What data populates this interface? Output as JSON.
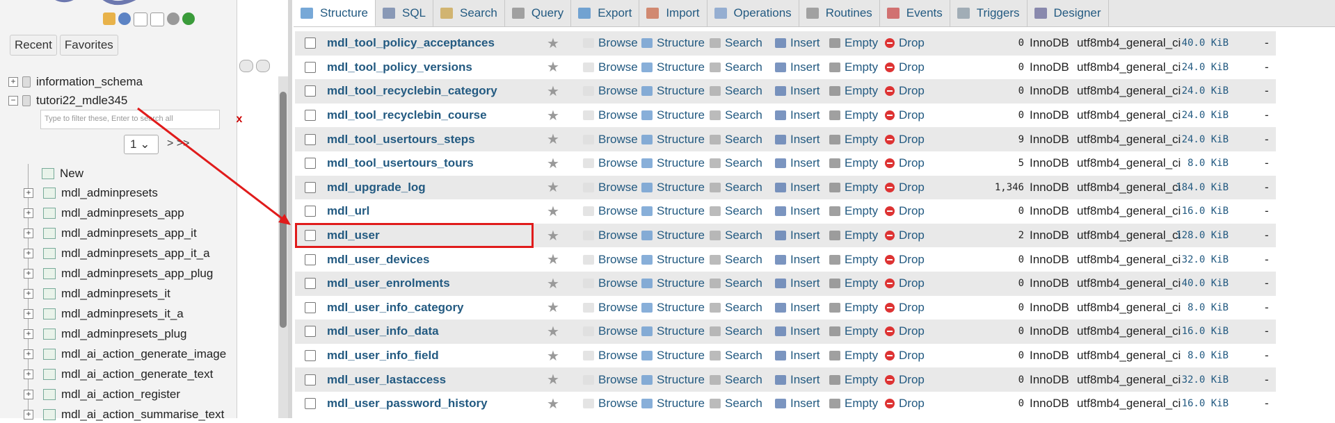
{
  "nav": {
    "recent_label": "Recent",
    "favorites_label": "Favorites",
    "databases": [
      {
        "name": "information_schema",
        "toggle": "+"
      },
      {
        "name": "tutori22_mdle345",
        "toggle": "−"
      }
    ],
    "filter_placeholder": "Type to filter these, Enter to search all",
    "filter_clear": "x",
    "page_select": "1",
    "page_next": "> >>",
    "new_label": "New",
    "tables": [
      "mdl_adminpresets",
      "mdl_adminpresets_app",
      "mdl_adminpresets_app_it",
      "mdl_adminpresets_app_it_a",
      "mdl_adminpresets_app_plug",
      "mdl_adminpresets_it",
      "mdl_adminpresets_it_a",
      "mdl_adminpresets_plug",
      "mdl_ai_action_generate_image",
      "mdl_ai_action_generate_text",
      "mdl_ai_action_register",
      "mdl_ai_action_summarise_text"
    ]
  },
  "tabs": [
    {
      "label": "Structure",
      "icon": "structure-icon"
    },
    {
      "label": "SQL",
      "icon": "sql-icon"
    },
    {
      "label": "Search",
      "icon": "search-icon"
    },
    {
      "label": "Query",
      "icon": "query-icon"
    },
    {
      "label": "Export",
      "icon": "export-icon"
    },
    {
      "label": "Import",
      "icon": "import-icon"
    },
    {
      "label": "Operations",
      "icon": "wrench-icon"
    },
    {
      "label": "Routines",
      "icon": "routines-icon"
    },
    {
      "label": "Events",
      "icon": "clock-icon"
    },
    {
      "label": "Triggers",
      "icon": "triggers-icon"
    },
    {
      "label": "Designer",
      "icon": "designer-icon"
    }
  ],
  "actions": {
    "browse": "Browse",
    "structure": "Structure",
    "search": "Search",
    "insert": "Insert",
    "empty": "Empty",
    "drop": "Drop"
  },
  "rows": [
    {
      "name": "mdl_tool_policy_acceptances",
      "rows": "0",
      "engine": "InnoDB",
      "collation": "utf8mb4_general_ci",
      "size": "40.0 KiB",
      "overhead": "-"
    },
    {
      "name": "mdl_tool_policy_versions",
      "rows": "0",
      "engine": "InnoDB",
      "collation": "utf8mb4_general_ci",
      "size": "24.0 KiB",
      "overhead": "-"
    },
    {
      "name": "mdl_tool_recyclebin_category",
      "rows": "0",
      "engine": "InnoDB",
      "collation": "utf8mb4_general_ci",
      "size": "24.0 KiB",
      "overhead": "-"
    },
    {
      "name": "mdl_tool_recyclebin_course",
      "rows": "0",
      "engine": "InnoDB",
      "collation": "utf8mb4_general_ci",
      "size": "24.0 KiB",
      "overhead": "-"
    },
    {
      "name": "mdl_tool_usertours_steps",
      "rows": "9",
      "engine": "InnoDB",
      "collation": "utf8mb4_general_ci",
      "size": "24.0 KiB",
      "overhead": "-"
    },
    {
      "name": "mdl_tool_usertours_tours",
      "rows": "5",
      "engine": "InnoDB",
      "collation": "utf8mb4_general_ci",
      "size": "8.0 KiB",
      "overhead": "-"
    },
    {
      "name": "mdl_upgrade_log",
      "rows": "1,346",
      "engine": "InnoDB",
      "collation": "utf8mb4_general_ci",
      "size": "184.0 KiB",
      "overhead": "-"
    },
    {
      "name": "mdl_url",
      "rows": "0",
      "engine": "InnoDB",
      "collation": "utf8mb4_general_ci",
      "size": "16.0 KiB",
      "overhead": "-"
    },
    {
      "name": "mdl_user",
      "rows": "2",
      "engine": "InnoDB",
      "collation": "utf8mb4_general_ci",
      "size": "128.0 KiB",
      "overhead": "-"
    },
    {
      "name": "mdl_user_devices",
      "rows": "0",
      "engine": "InnoDB",
      "collation": "utf8mb4_general_ci",
      "size": "32.0 KiB",
      "overhead": "-"
    },
    {
      "name": "mdl_user_enrolments",
      "rows": "0",
      "engine": "InnoDB",
      "collation": "utf8mb4_general_ci",
      "size": "40.0 KiB",
      "overhead": "-"
    },
    {
      "name": "mdl_user_info_category",
      "rows": "0",
      "engine": "InnoDB",
      "collation": "utf8mb4_general_ci",
      "size": "8.0 KiB",
      "overhead": "-"
    },
    {
      "name": "mdl_user_info_data",
      "rows": "0",
      "engine": "InnoDB",
      "collation": "utf8mb4_general_ci",
      "size": "16.0 KiB",
      "overhead": "-"
    },
    {
      "name": "mdl_user_info_field",
      "rows": "0",
      "engine": "InnoDB",
      "collation": "utf8mb4_general_ci",
      "size": "8.0 KiB",
      "overhead": "-"
    },
    {
      "name": "mdl_user_lastaccess",
      "rows": "0",
      "engine": "InnoDB",
      "collation": "utf8mb4_general_ci",
      "size": "32.0 KiB",
      "overhead": "-"
    },
    {
      "name": "mdl_user_password_history",
      "rows": "0",
      "engine": "InnoDB",
      "collation": "utf8mb4_general_ci",
      "size": "16.0 KiB",
      "overhead": "-"
    }
  ],
  "colors": {
    "link": "#235a81",
    "highlight": "#e01b1b",
    "drop": "#d33333"
  }
}
